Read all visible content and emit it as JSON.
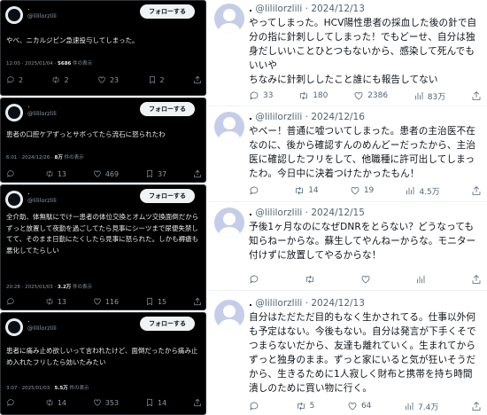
{
  "dark_posts": [
    {
      "dot": ".",
      "handle": "@lililorzlili",
      "follow_label": "フォローする",
      "text": "やべ、ニカルジピン急速投与してしまった。",
      "time": "12:00 · 2025/01/04 ·",
      "views": "5686",
      "views_suffix": "件の表示",
      "stats": {
        "reply": "2",
        "retweet": "2",
        "like": "23",
        "bookmark": "2"
      }
    },
    {
      "dot": ".",
      "handle": "@lililorzlili",
      "follow_label": "フォローする",
      "text": "患者の口腔ケアずっとサボってたら流石に怒られたわ",
      "time": "6:01 · 2024/12/26 ·",
      "views": "8万",
      "views_suffix": "件の表示",
      "stats": {
        "reply": "",
        "retweet": "13",
        "like": "469",
        "bookmark": "37"
      }
    },
    {
      "dot": ".",
      "handle": "@lililorzlili",
      "follow_label": "フォローする",
      "text": "全介助、体無駄にでけー患者の体位交換とオムツ交換面倒だからずっと放置して夜勤を過ごしてたら見事にシーツまで尿便失禁してて、そのまま日勤にたくしたら見事に怒られた。しかも褥瘡も悪化してたらしい",
      "time": "20:28 · 2025/01/03 ·",
      "views": "3.2万",
      "views_suffix": "件の表示",
      "stats": {
        "reply": "",
        "retweet": "13",
        "like": "116",
        "bookmark": "15"
      }
    },
    {
      "dot": ".",
      "handle": "@lililorzlili",
      "follow_label": "フォローする",
      "text": "患者に痛み止め欲しいって言われたけど、面倒だったから痛み止め入れたフリしたら効いたみたい",
      "time": "3:07 · 2025/01/03 ·",
      "views": "5.5万",
      "views_suffix": "件の表示",
      "stats": {
        "reply": "",
        "retweet": "14",
        "like": "353",
        "bookmark": "14"
      }
    }
  ],
  "light_posts": [
    {
      "dot": ".",
      "handle": "@lililorzlili",
      "date": "· 2024/12/13",
      "text": "やってしまった。HCV陽性患者の採血した後の針で自分の指に針刺ししてしまった！でもどーせ、自分は独身だしいいことひとつもないから、感染して死んでもいいや\nちなみに針刺ししたこと誰にも報告してない",
      "stats": {
        "reply": "33",
        "retweet": "180",
        "like": "2386",
        "views": "83万"
      }
    },
    {
      "dot": ".",
      "handle": "@lililorzlili",
      "date": "· 2024/12/16",
      "text": "やべー！普通に嘘ついてしまった。患者の主治医不在なのに、後から確認すんのめんどーだったから、主治医に確認したフリをして、他職種に許可出してしまったわ。今日中に決着つけたかったもん！",
      "stats": {
        "reply": "",
        "retweet": "14",
        "like": "19",
        "views": "4.5万"
      }
    },
    {
      "dot": ".",
      "handle": "@lililorzlili",
      "date": "· 2024/12/15",
      "text": "予後1ヶ月なのになぜDNRをとらない？どうなっても知らねーからな。蘇生してやんねーからな。モニター付けずに放置してやるからな！",
      "stats": {
        "reply": "",
        "retweet": "",
        "like": "",
        "views": ""
      }
    },
    {
      "dot": ".",
      "handle": "@lililorzlili",
      "date": "· 2024/12/13",
      "text": "自分はただただ目的もなく生かされてる。仕事以外何も予定はない。今後もない。自分は発言が下手くそでつまらないだから、友達も離れていく。生まれてからずっと独身のまま。ずっと家にいると気が狂いそうだから、生きるために1人寂しく財布と携帯を持ち時間潰しのために買い物に行く。",
      "stats": {
        "reply": "",
        "retweet": "5",
        "like": "64",
        "views": "7.4万"
      }
    }
  ],
  "icons": {
    "reply": "reply-icon",
    "retweet": "retweet-icon",
    "like": "heart-icon",
    "bookmark": "bookmark-icon",
    "views": "views-icon",
    "share": "share-icon"
  },
  "colors": {
    "dark_bg": "#000000",
    "light_bg": "#ffffff",
    "muted_dark": "#8b98a5",
    "muted_light": "#536471"
  }
}
